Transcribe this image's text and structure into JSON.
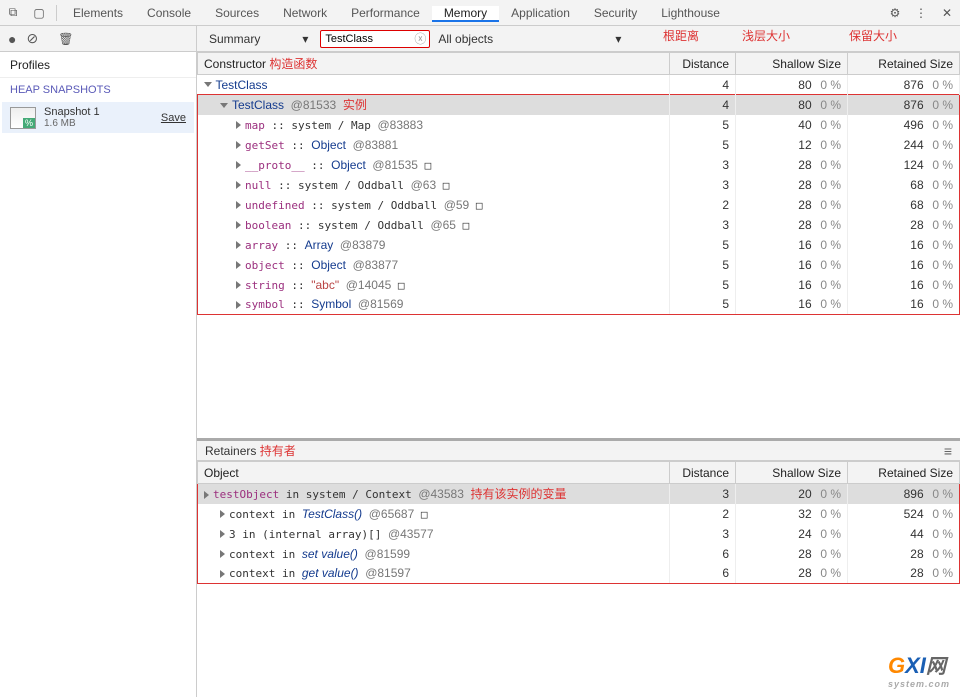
{
  "tabs": [
    "Elements",
    "Console",
    "Sources",
    "Network",
    "Performance",
    "Memory",
    "Application",
    "Security",
    "Lighthouse"
  ],
  "active_tab": "Memory",
  "left": {
    "profiles": "Profiles",
    "heap": "HEAP SNAPSHOTS",
    "snapshot_name": "Snapshot 1",
    "snapshot_size": "1.6 MB",
    "save": "Save"
  },
  "filter": {
    "view_label": "Summary",
    "input_value": "TestClass",
    "obj_filter": "All objects"
  },
  "annotations": {
    "distance": "根距离",
    "shallow": "浅层大小",
    "retained": "保留大小",
    "constructor_zh": "构造函数",
    "instance_zh": "实例",
    "retainers_zh": "持有者",
    "holder_zh": "持有该实例的变量"
  },
  "columns": {
    "constructor": "Constructor",
    "distance": "Distance",
    "shallow": "Shallow Size",
    "retained": "Retained Size",
    "object": "Object"
  },
  "retainers_label": "Retainers",
  "rows": [
    {
      "indent": 0,
      "open": true,
      "sel": false,
      "red": false,
      "html": "<span class='cls'>TestClass</span>",
      "d": 4,
      "s": 80,
      "sp": "0 %",
      "r": 876,
      "rp": "0 %"
    },
    {
      "indent": 1,
      "open": true,
      "sel": true,
      "red": "top",
      "html": "<span class='cls'>TestClass</span> <span class='addr'>@81533</span> <span class='red'>实例</span>",
      "d": 4,
      "s": 80,
      "sp": "0 %",
      "r": 876,
      "rp": "0 %"
    },
    {
      "indent": 2,
      "open": false,
      "sel": false,
      "red": "mid",
      "html": "<span class='prop mono'>map</span> <span class='mono'>::</span> system / Map <span class='addr'>@83883</span>",
      "d": 5,
      "s": 40,
      "sp": "0 %",
      "r": 496,
      "rp": "0 %"
    },
    {
      "indent": 2,
      "open": false,
      "sel": false,
      "red": "mid",
      "html": "<span class='prop mono'>getSet</span> <span class='mono'>::</span> <span class='cls'>Object</span> <span class='addr'>@83881</span>",
      "d": 5,
      "s": 12,
      "sp": "0 %",
      "r": 244,
      "rp": "0 %"
    },
    {
      "indent": 2,
      "open": false,
      "sel": false,
      "red": "mid",
      "html": "<span class='prop mono'>__proto__</span> <span class='mono'>::</span> <span class='cls'>Object</span> <span class='addr'>@81535</span> &#9633;",
      "d": 3,
      "s": 28,
      "sp": "0 %",
      "r": 124,
      "rp": "0 %"
    },
    {
      "indent": 2,
      "open": false,
      "sel": false,
      "red": "mid",
      "html": "<span class='prop mono'>null</span> <span class='mono'>::</span> system / Oddball <span class='addr'>@63</span> &#9633;",
      "d": 3,
      "s": 28,
      "sp": "0 %",
      "r": 68,
      "rp": "0 %"
    },
    {
      "indent": 2,
      "open": false,
      "sel": false,
      "red": "mid",
      "html": "<span class='prop mono'>undefined</span> <span class='mono'>::</span> system / Oddball <span class='addr'>@59</span> &#9633;",
      "d": 2,
      "s": 28,
      "sp": "0 %",
      "r": 68,
      "rp": "0 %"
    },
    {
      "indent": 2,
      "open": false,
      "sel": false,
      "red": "mid",
      "html": "<span class='prop mono'>boolean</span> <span class='mono'>::</span> system / Oddball <span class='addr'>@65</span> &#9633;",
      "d": 3,
      "s": 28,
      "sp": "0 %",
      "r": 28,
      "rp": "0 %"
    },
    {
      "indent": 2,
      "open": false,
      "sel": false,
      "red": "mid",
      "html": "<span class='prop mono'>array</span> <span class='mono'>::</span> <span class='cls'>Array</span> <span class='addr'>@83879</span>",
      "d": 5,
      "s": 16,
      "sp": "0 %",
      "r": 16,
      "rp": "0 %"
    },
    {
      "indent": 2,
      "open": false,
      "sel": false,
      "red": "mid",
      "html": "<span class='prop mono'>object</span> <span class='mono'>::</span> <span class='cls'>Object</span> <span class='addr'>@83877</span>",
      "d": 5,
      "s": 16,
      "sp": "0 %",
      "r": 16,
      "rp": "0 %"
    },
    {
      "indent": 2,
      "open": false,
      "sel": false,
      "red": "mid",
      "html": "<span class='prop mono'>string</span> <span class='mono'>::</span> <span class='str'>\"abc\"</span> <span class='addr'>@14045</span> &#9633;",
      "d": 5,
      "s": 16,
      "sp": "0 %",
      "r": 16,
      "rp": "0 %"
    },
    {
      "indent": 2,
      "open": false,
      "sel": false,
      "red": "bot",
      "html": "<span class='prop mono'>symbol</span> <span class='mono'>::</span> <span class='cls'>Symbol</span> <span class='addr'>@81569</span>",
      "d": 5,
      "s": 16,
      "sp": "0 %",
      "r": 16,
      "rp": "0 %"
    }
  ],
  "retainers": [
    {
      "indent": 0,
      "open": false,
      "sel": true,
      "red": "top",
      "html": "<span class='prop mono'>testObject</span> in system / Context <span class='addr'>@43583</span> <span class='red'>持有该实例的变量</span>",
      "d": 3,
      "s": 20,
      "sp": "0 %",
      "r": 896,
      "rp": "0 %"
    },
    {
      "indent": 1,
      "open": false,
      "sel": false,
      "red": "mid",
      "html": "<span class='mono'>context</span> in <span class='cls'><i>TestClass()</i></span> <span class='addr'>@65687</span> &#9633;",
      "d": 2,
      "s": 32,
      "sp": "0 %",
      "r": 524,
      "rp": "0 %"
    },
    {
      "indent": 1,
      "open": false,
      "sel": false,
      "red": "mid",
      "html": "<span class='mono'>3</span> in (internal array)[] <span class='addr'>@43577</span>",
      "d": 3,
      "s": 24,
      "sp": "0 %",
      "r": 44,
      "rp": "0 %"
    },
    {
      "indent": 1,
      "open": false,
      "sel": false,
      "red": "mid",
      "html": "<span class='mono'>context</span> in <span class='cls'><i>set value()</i></span> <span class='addr'>@81599</span>",
      "d": 6,
      "s": 28,
      "sp": "0 %",
      "r": 28,
      "rp": "0 %"
    },
    {
      "indent": 1,
      "open": false,
      "sel": false,
      "red": "bot",
      "html": "<span class='mono'>context</span> in <span class='cls'><i>get value()</i></span> <span class='addr'>@81597</span>",
      "d": 6,
      "s": 28,
      "sp": "0 %",
      "r": 28,
      "rp": "0 %"
    }
  ],
  "watermark": {
    "brand1": "G",
    "brand2": "XI",
    "brand3": "网",
    "sub": "system.com"
  }
}
